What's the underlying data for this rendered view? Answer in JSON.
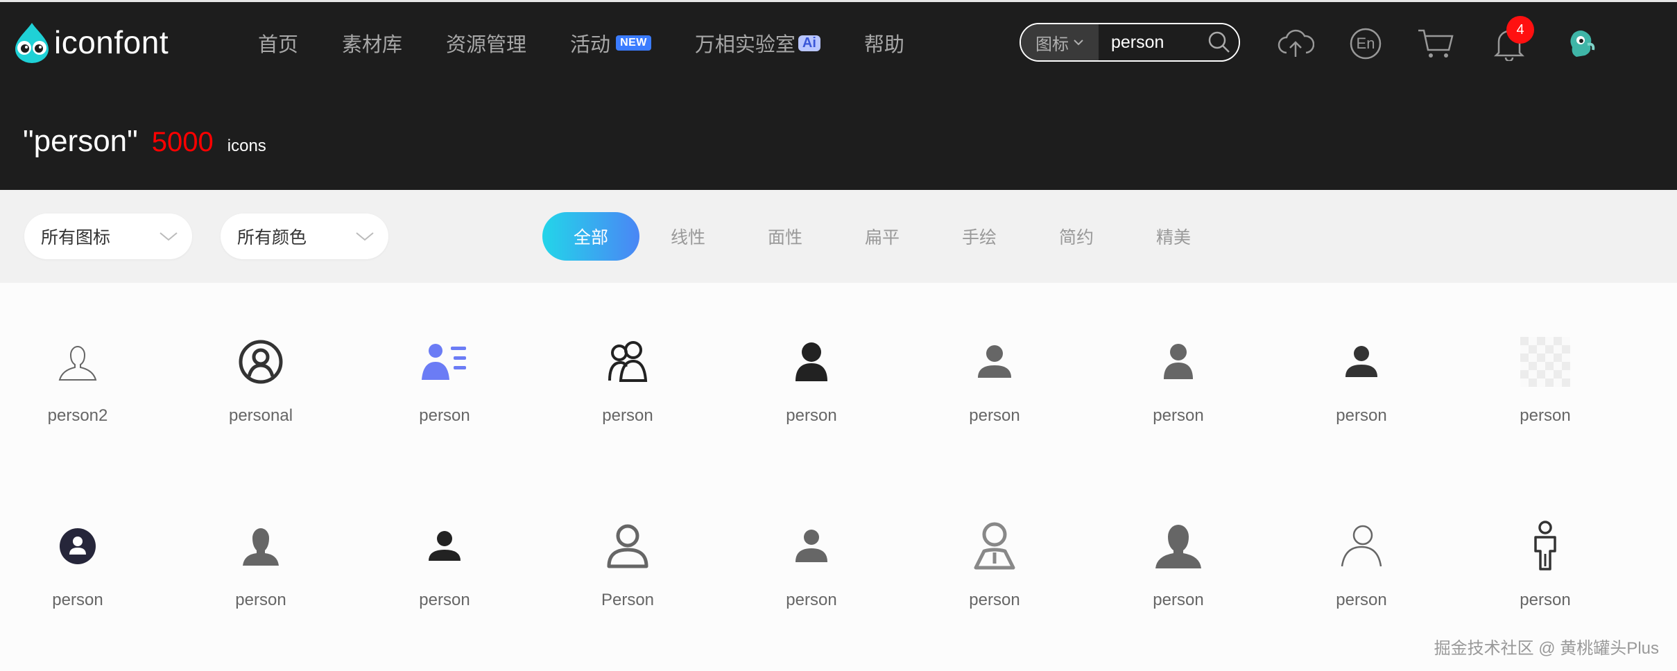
{
  "header": {
    "logo_text": "iconfont",
    "nav": [
      {
        "label": "首页"
      },
      {
        "label": "素材库"
      },
      {
        "label": "资源管理"
      },
      {
        "label": "活动",
        "badge": "NEW"
      },
      {
        "label": "万相实验室",
        "badge": "Ai"
      },
      {
        "label": "帮助"
      }
    ],
    "search": {
      "type_label": "图标",
      "value": "person"
    },
    "notification_count": "4",
    "lang_label": "En"
  },
  "result": {
    "query": "\"person\"",
    "count": "5000",
    "unit": "icons"
  },
  "filters": {
    "icon_select": "所有图标",
    "color_select": "所有颜色",
    "tabs": [
      "全部",
      "线性",
      "面性",
      "扁平",
      "手绘",
      "简约",
      "精美"
    ],
    "active_tab": "全部"
  },
  "icons": [
    {
      "name": "person2",
      "icon": "person-outline-icon",
      "color": "#666666"
    },
    {
      "name": "personal",
      "icon": "person-circle-outline-icon",
      "color": "#333333"
    },
    {
      "name": "person",
      "icon": "person-card-icon",
      "color": "#6b7cf5"
    },
    {
      "name": "person",
      "icon": "two-persons-icon",
      "color": "#222222"
    },
    {
      "name": "person",
      "icon": "person-solid-icon",
      "color": "#222222"
    },
    {
      "name": "person",
      "icon": "person-solid-icon",
      "color": "#666666"
    },
    {
      "name": "person",
      "icon": "person-solid-icon",
      "color": "#666666"
    },
    {
      "name": "person",
      "icon": "person-solid-icon",
      "color": "#333333"
    },
    {
      "name": "person",
      "icon": "transparent-placeholder-icon",
      "color": "#e0e0e0"
    },
    {
      "name": "person",
      "icon": "person-in-circle-icon",
      "color": "#26263a"
    },
    {
      "name": "person",
      "icon": "person-bust-icon",
      "color": "#666666"
    },
    {
      "name": "person",
      "icon": "person-solid-icon",
      "color": "#222222"
    },
    {
      "name": "Person",
      "icon": "person-outline-icon",
      "color": "#666666"
    },
    {
      "name": "person",
      "icon": "person-solid-icon",
      "color": "#666666"
    },
    {
      "name": "person",
      "icon": "person-tie-outline-icon",
      "color": "#888888"
    },
    {
      "name": "person",
      "icon": "person-bust-icon",
      "color": "#666666"
    },
    {
      "name": "person",
      "icon": "person-thin-outline-icon",
      "color": "#666666"
    },
    {
      "name": "person",
      "icon": "person-standing-icon",
      "color": "#333333"
    }
  ],
  "watermark": "掘金技术社区 @ 黄桃罐头Plus"
}
